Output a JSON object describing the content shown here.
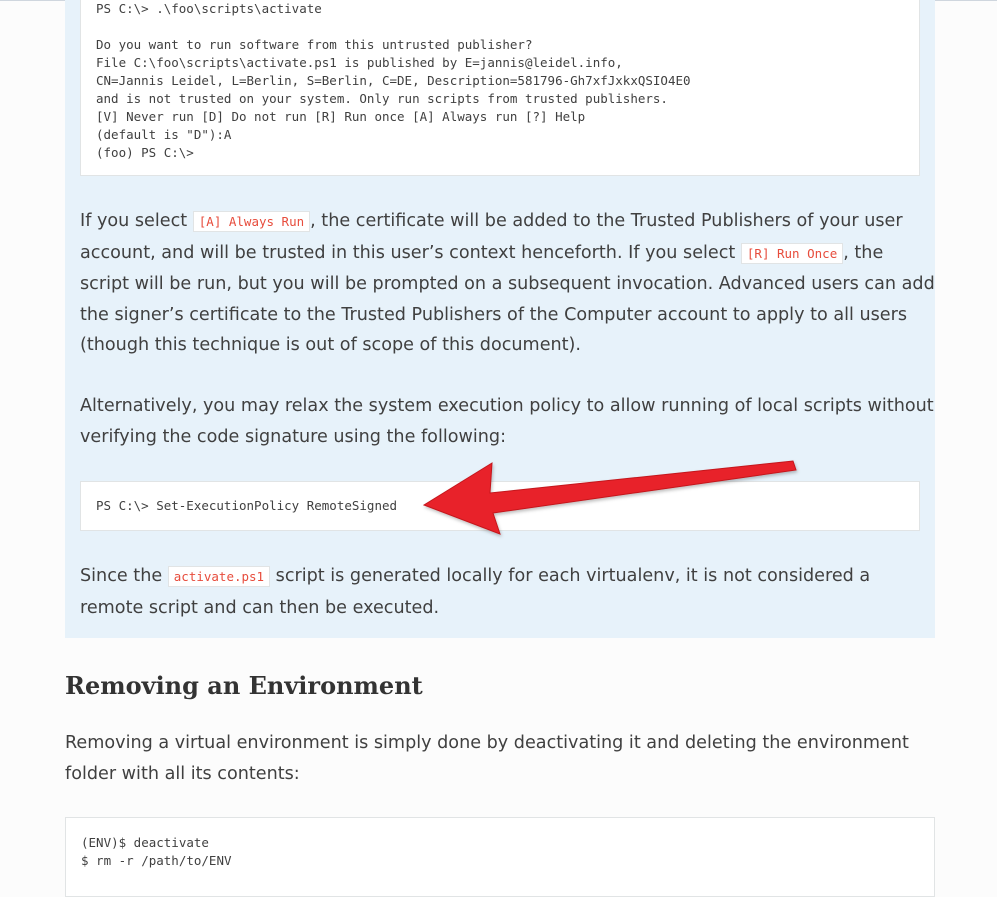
{
  "code_blocks": {
    "activate_session": [
      "PS C:\\> .\\foo\\scripts\\activate",
      "",
      "Do you want to run software from this untrusted publisher?",
      "File C:\\foo\\scripts\\activate.ps1 is published by E=jannis@leidel.info,",
      "CN=Jannis Leidel, L=Berlin, S=Berlin, C=DE, Description=581796-Gh7xfJxkxQSIO4E0",
      "and is not trusted on your system. Only run scripts from trusted publishers.",
      "[V] Never run  [D] Do not run  [R] Run once  [A] Always run  [?] Help",
      "(default is \"D\"):A",
      "(foo) PS C:\\>"
    ],
    "set_policy": "PS C:\\> Set-ExecutionPolicy RemoteSigned",
    "remove_env": [
      "(ENV)$ deactivate",
      "$ rm -r /path/to/ENV"
    ]
  },
  "paragraph1": {
    "l1_a": "If you select ",
    "l1_code": "[A] Always Run",
    "l1_b": ", the certificate will be added to the Trusted Publishers of your user",
    "l2_a": "account, and will be trusted in this user’s context henceforth. If you select ",
    "l2_code": "[R] Run Once",
    "l2_b": ", the",
    "l3": "script will be run, but you will be prompted on a subsequent invocation. Advanced users can add",
    "l4": "the signer’s certificate to the Trusted Publishers of the Computer account to apply to all users",
    "l5": "(though this technique is out of scope of this document)."
  },
  "paragraph2": {
    "l1": "Alternatively, you may relax the system execution policy to allow running of local scripts without",
    "l2": "verifying the code signature using the following:"
  },
  "paragraph3": {
    "l1_a": "Since the ",
    "l1_code": "activate.ps1",
    "l1_b": " script is generated locally for each virtualenv, it is not considered a",
    "l2": "remote script and can then be executed."
  },
  "section": {
    "heading": "Removing an Environment",
    "l1": "Removing a virtual environment is simply done by deactivating it and deleting the environment",
    "l2": "folder with all its contents:"
  },
  "colors": {
    "note_bg": "#e7f2fa",
    "inline_code": "#e74c3c",
    "arrow": "#e8242b"
  }
}
